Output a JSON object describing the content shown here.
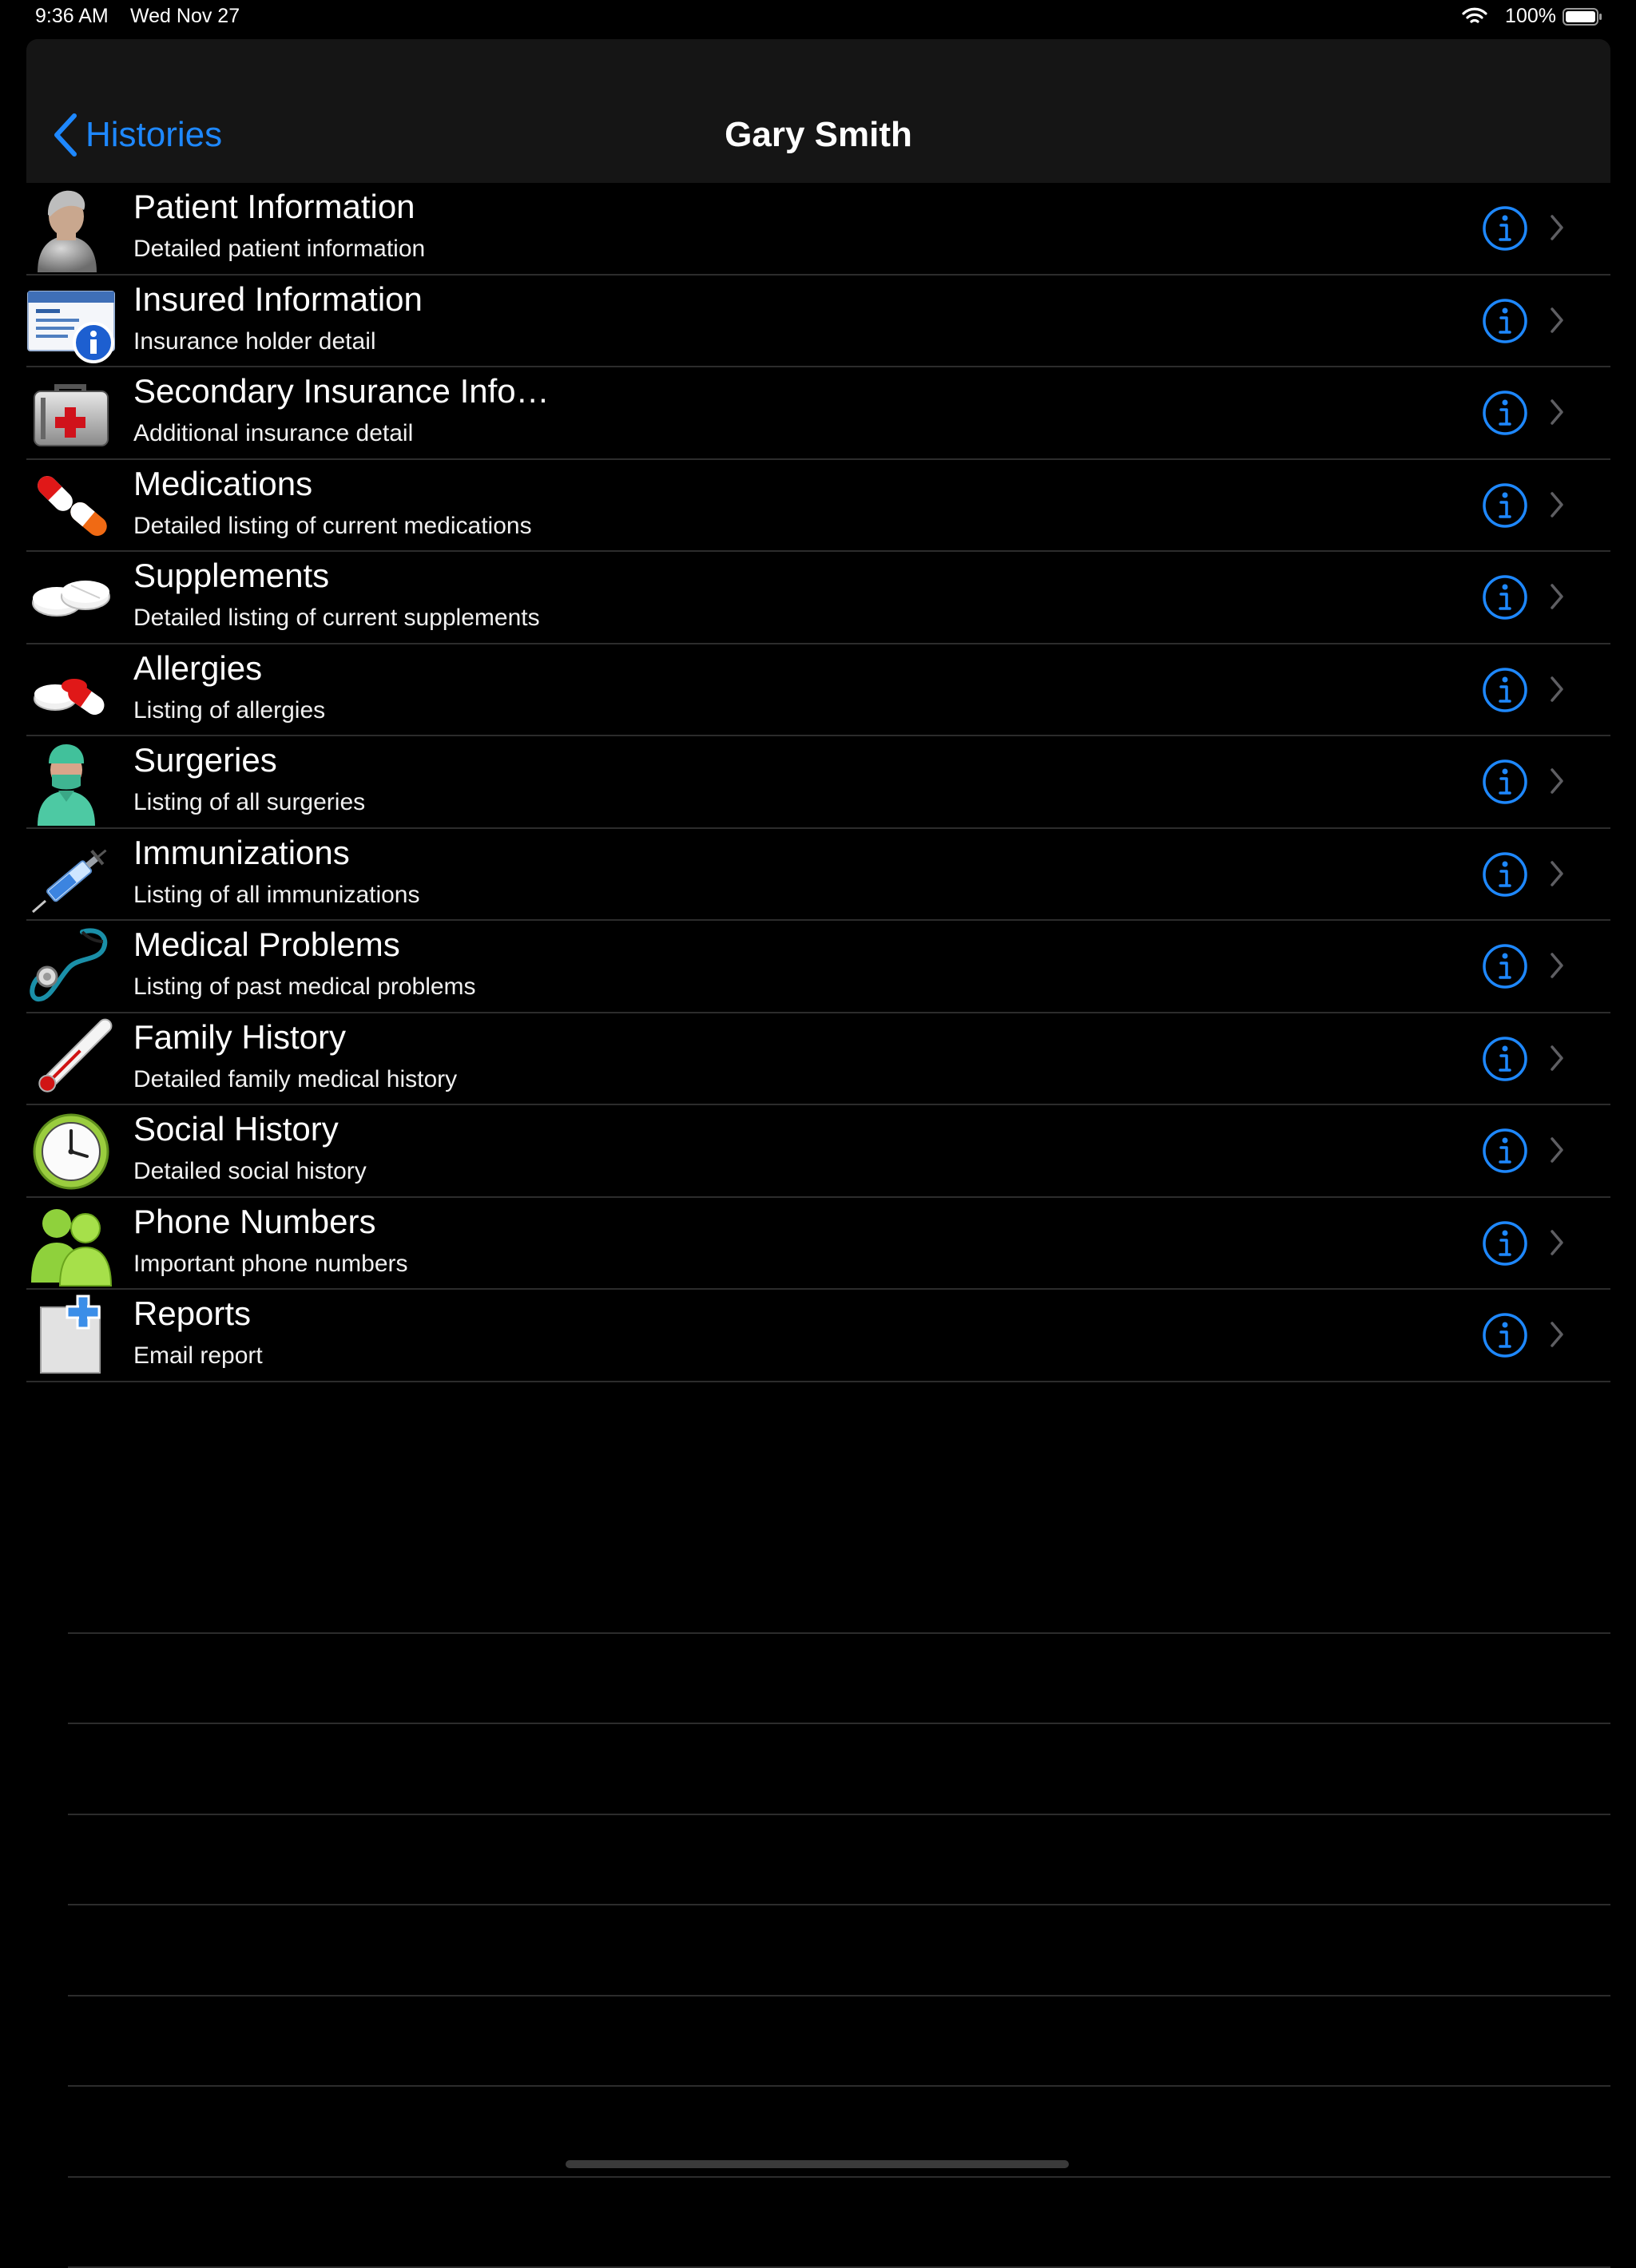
{
  "status_bar": {
    "time": "9:36 AM",
    "date": "Wed Nov 27",
    "battery": "100%",
    "wifi_icon": "wifi-icon",
    "battery_icon": "battery-icon"
  },
  "nav": {
    "back_label": "Histories",
    "title": "Gary Smith",
    "accent_color": "#1e88ff"
  },
  "items": [
    {
      "title": "Patient Information",
      "subtitle": "Detailed patient information",
      "icon": "patient-icon"
    },
    {
      "title": "Insured Information",
      "subtitle": "Insurance holder detail",
      "icon": "insurance-card-icon"
    },
    {
      "title": "Secondary Insurance Info…",
      "subtitle": "Additional insurance detail",
      "icon": "first-aid-kit-icon"
    },
    {
      "title": "Medications",
      "subtitle": "Detailed listing of current medications",
      "icon": "capsule-icon"
    },
    {
      "title": "Supplements",
      "subtitle": "Detailed listing of current supplements",
      "icon": "tablets-icon"
    },
    {
      "title": "Allergies",
      "subtitle": "Listing of allergies",
      "icon": "pills-icon"
    },
    {
      "title": "Surgeries",
      "subtitle": "Listing of all surgeries",
      "icon": "surgeon-icon"
    },
    {
      "title": "Immunizations",
      "subtitle": "Listing of all immunizations",
      "icon": "syringe-icon"
    },
    {
      "title": "Medical Problems",
      "subtitle": "Listing of past medical problems",
      "icon": "stethoscope-icon"
    },
    {
      "title": "Family History",
      "subtitle": "Detailed family medical history",
      "icon": "thermometer-icon"
    },
    {
      "title": "Social History",
      "subtitle": "Detailed social history",
      "icon": "clock-icon"
    },
    {
      "title": "Phone Numbers",
      "subtitle": "Important phone numbers",
      "icon": "contacts-icon"
    },
    {
      "title": "Reports",
      "subtitle": "Email report",
      "icon": "new-report-icon"
    }
  ]
}
